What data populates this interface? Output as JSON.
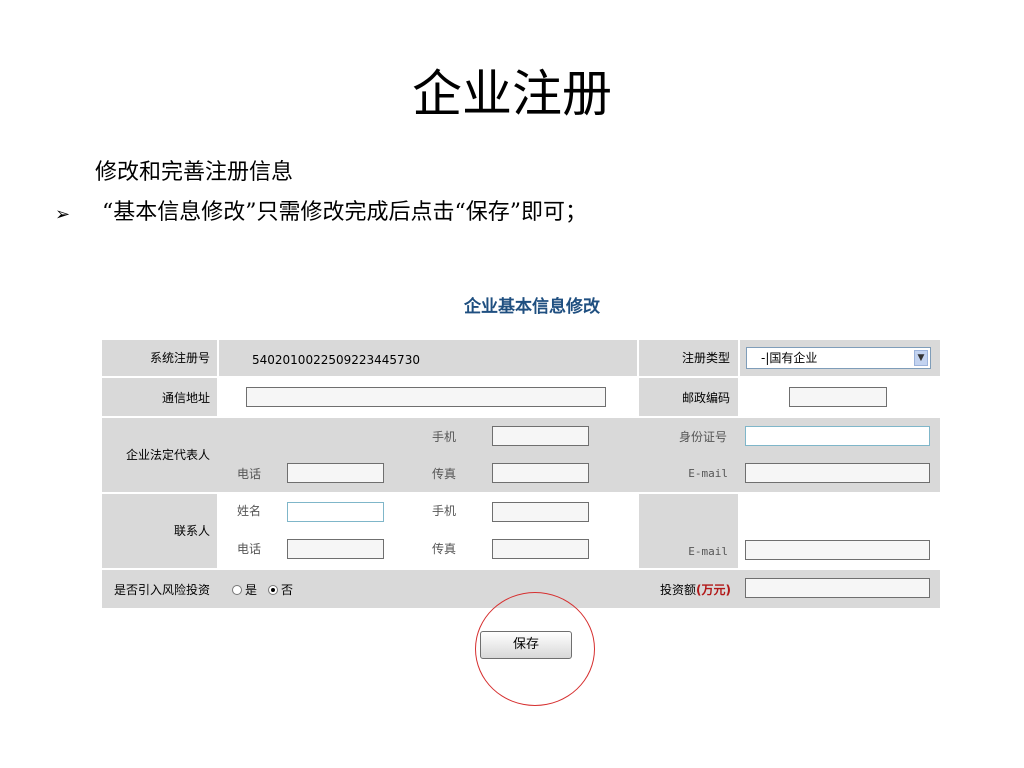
{
  "slide": {
    "title": "企业注册",
    "subtitle": "修改和完善注册信息",
    "bullet_mark": "➢",
    "bullet": "“基本信息修改”只需修改完成后点击“保存”即可；"
  },
  "form": {
    "title": "企业基本信息修改",
    "reg_no_label": "系统注册号",
    "reg_no_value": "5402010022509223445730",
    "reg_type_label": "注册类型",
    "reg_type_value": "-|国有企业",
    "address_label": "通信地址",
    "postcode_label": "邮政编码",
    "legal_rep_label": "企业法定代表人",
    "mobile_label": "手机",
    "id_label": "身份证号",
    "phone_label": "电话",
    "fax_label": "传真",
    "email_label": "E-mail",
    "contact_label": "联系人",
    "name_label": "姓名",
    "risk_label": "是否引入风险投资",
    "yes_label": "是",
    "no_label": "否",
    "invest_label": "投资额",
    "invest_unit": "(万元)",
    "save_label": "保存",
    "selected_risk_option": "否"
  },
  "colors": {
    "bar": "#d9d9d9",
    "title_blue": "#1f4f80",
    "highlight_circle": "#d63030",
    "unit_red": "#b21818"
  }
}
